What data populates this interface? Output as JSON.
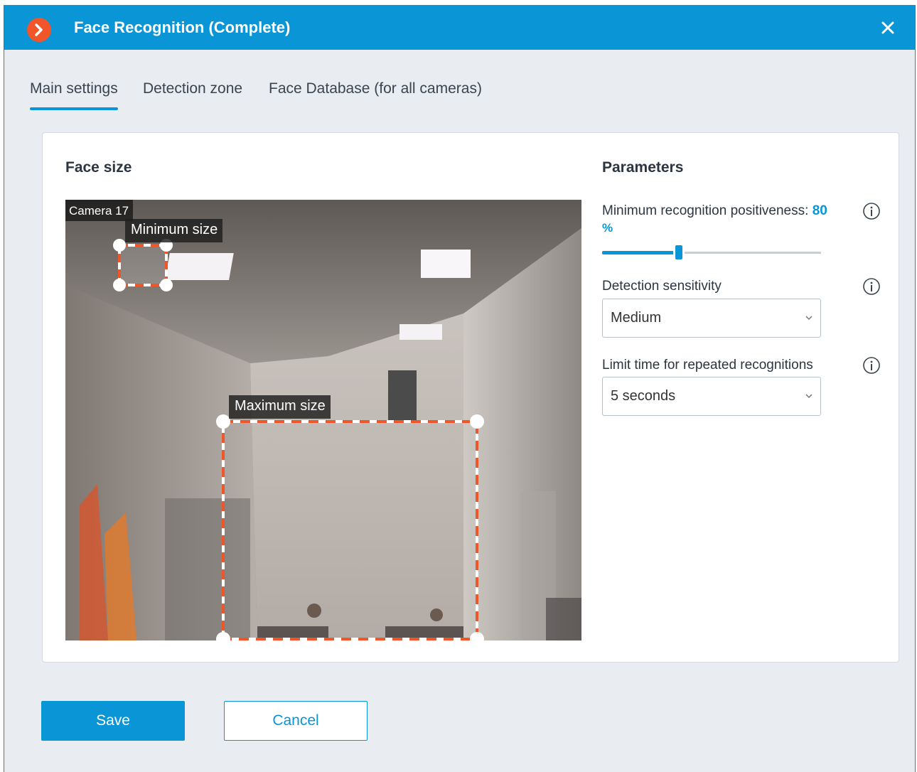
{
  "window": {
    "title": "Face Recognition (Complete)",
    "accent_color": "#0a95d6",
    "logo_color": "#f0562a",
    "logo_icon": "chevron-right-icon",
    "close_icon": "close-icon"
  },
  "tabs": [
    {
      "label": "Main settings",
      "active": true
    },
    {
      "label": "Detection zone",
      "active": false
    },
    {
      "label": "Face Database (for all cameras)",
      "active": false
    }
  ],
  "face_size": {
    "heading": "Face size",
    "camera_name": "Camera 17",
    "min_label": "Minimum size",
    "max_label": "Maximum size",
    "zone_color": "#f0562a"
  },
  "parameters": {
    "heading": "Parameters",
    "positiveness": {
      "label": "Minimum recognition positiveness:",
      "value": "80",
      "unit": "%",
      "slider_fraction": 0.35
    },
    "sensitivity": {
      "label": "Detection sensitivity",
      "value": "Medium"
    },
    "repeat_limit": {
      "label": "Limit time for repeated recognitions",
      "value": "5 seconds"
    }
  },
  "buttons": {
    "save": "Save",
    "cancel": "Cancel"
  }
}
